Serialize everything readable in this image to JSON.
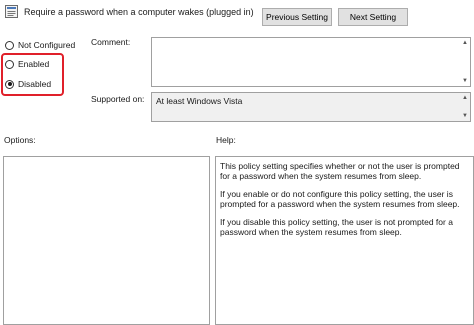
{
  "header": {
    "title": "Require a password when a computer wakes (plugged in)",
    "previous_setting": "Previous Setting",
    "next_setting": "Next Setting"
  },
  "state": {
    "not_configured": "Not Configured",
    "enabled": "Enabled",
    "disabled": "Disabled",
    "selected": "Disabled"
  },
  "comment": {
    "label": "Comment:",
    "value": ""
  },
  "supported_on": {
    "label": "Supported on:",
    "value": "At least Windows Vista"
  },
  "options": {
    "label": "Options:"
  },
  "help": {
    "label": "Help:",
    "paragraphs": [
      "This policy setting specifies whether or not the user is prompted for a password when the system resumes from sleep.",
      "If you enable or do not configure this policy setting, the user is prompted for a password when the system resumes from sleep.",
      "If you disable this policy setting, the user is not prompted for a password when the system resumes from sleep."
    ]
  },
  "colors": {
    "highlight": "#e0202a",
    "button_bg": "#e1e1e1",
    "border": "#a0a0a0"
  },
  "icons": [
    "policy-settings-icon",
    "scroll-up-arrow-icon",
    "scroll-down-arrow-icon"
  ]
}
